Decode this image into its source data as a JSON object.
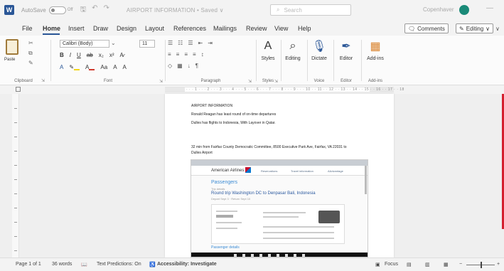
{
  "titlebar": {
    "app_icon": "W",
    "autosave_label": "AutoSave",
    "autosave_state": "Off",
    "save_icon": "save-icon",
    "undo_icon": "undo-icon",
    "redo_icon": "redo-icon",
    "doc_title": "AIRPORT INFORMATION • Saved ∨",
    "search_placeholder": "Search",
    "user_name": "Copenhaver",
    "minimize_glyph": "—"
  },
  "tabs": {
    "items": [
      "File",
      "Home",
      "Insert",
      "Draw",
      "Design",
      "Layout",
      "References",
      "Mailings",
      "Review",
      "View",
      "Help"
    ],
    "active": "Home",
    "comments_label": "Comments",
    "editing_label": "Editing",
    "editing_chevron": "∨"
  },
  "ribbon": {
    "clipboard": {
      "paste_label": "Paste",
      "group_label": "Clipboard",
      "cut_glyph": "✂",
      "copy_glyph": "⧉",
      "brush_glyph": "✎"
    },
    "font": {
      "family": "Calibri (Body)",
      "size": "11",
      "group_label": "Font",
      "row1": [
        "B",
        "I",
        "U",
        "ab",
        "x₂",
        "x²",
        "A̷"
      ],
      "row2": [
        "A",
        "✎",
        "A",
        "Aa",
        "A",
        "A"
      ]
    },
    "paragraph": {
      "group_label": "Paragraph",
      "row1": [
        "☰",
        "☷",
        "☰",
        "⇤",
        "⇥"
      ],
      "row2": [
        "≡",
        "≡",
        "≡",
        "≡",
        "↕"
      ],
      "row3": [
        "◇",
        "▦",
        "↓",
        "¶"
      ]
    },
    "styles": {
      "label": "Styles",
      "group_label": "Styles"
    },
    "editing": {
      "label": "Editing"
    },
    "voice": {
      "dictate_label": "Dictate",
      "group_label": "Voice"
    },
    "editor": {
      "label": "Editor",
      "group_label": "Editor"
    },
    "addins": {
      "label": "Add-ins",
      "group_label": "Add-ins"
    }
  },
  "ruler": {
    "numbers": "· · · 1 · · · 2 · · · 3 · · · 4 · · · 5 · · · 6 · · · 7 · · · 8 · · · 9 · · · 10 · · 11 · · 12 · · 13 · · 14 · · 15 · · 16 · · 17 · · 18"
  },
  "document": {
    "lines": [
      "AIRPORT INFORMATION",
      "Ronald Reagan has least round of on-time departures",
      "Dulles has flights to Indonesia, With Layover in Qatar.",
      "32 min from Fairfax County Democratic Committee, 8500 Executive Park Ave, Fairfax, VA 22031 to",
      "Dulles Airport"
    ],
    "embedded": {
      "brand": "American Airlines",
      "nav": [
        "Reservations",
        "Travel information",
        "AAdvantage"
      ],
      "page_title": "Passengers",
      "sub": "Trip details",
      "route": "Round trip Washington DC to Denpasar Bali, Indonesia",
      "dates": "Depart Sept 3 · Return Sept 10",
      "bottom_link": "Passenger details"
    }
  },
  "statusbar": {
    "page": "Page 1 of 1",
    "words": "36 words",
    "proof_icon": "proofing-icon",
    "predictions": "Text Predictions: On",
    "accessibility": "Accessibility: Investigate",
    "focus": "Focus",
    "zoom_minus": "−",
    "zoom_plus": "+"
  }
}
